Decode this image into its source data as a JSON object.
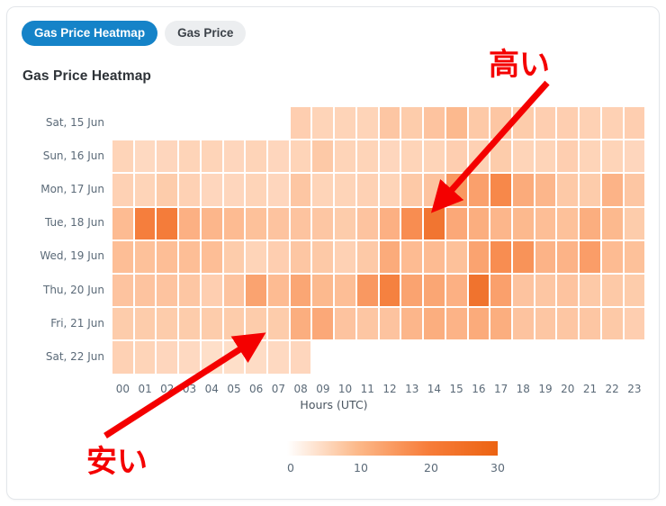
{
  "tabs": [
    {
      "label": "Gas Price Heatmap",
      "active": true
    },
    {
      "label": "Gas Price",
      "active": false
    }
  ],
  "chart_title": "Gas Price Heatmap",
  "annotations": [
    {
      "text": "高い",
      "meaning": "high",
      "color": "#f40000"
    },
    {
      "text": "安い",
      "meaning": "cheap",
      "color": "#f40000"
    }
  ],
  "legend": {
    "ticks": [
      "0",
      "10",
      "20",
      "30"
    ],
    "colors": [
      "#fdf0e6",
      "#fcb98a",
      "#f77d3a",
      "#ec6312"
    ]
  },
  "chart_data": {
    "type": "heatmap",
    "title": "Gas Price Heatmap",
    "xlabel": "Hours (UTC)",
    "ylabel": "",
    "categories_x": [
      "00",
      "01",
      "02",
      "03",
      "04",
      "05",
      "06",
      "07",
      "08",
      "09",
      "10",
      "11",
      "12",
      "13",
      "14",
      "15",
      "16",
      "17",
      "18",
      "19",
      "20",
      "21",
      "22",
      "23"
    ],
    "categories_y": [
      "Sat, 15 Jun",
      "Sun, 16 Jun",
      "Mon, 17 Jun",
      "Tue, 18 Jun",
      "Wed, 19 Jun",
      "Thu, 20 Jun",
      "Fri, 21 Jun",
      "Sat, 22 Jun"
    ],
    "zlim": [
      0,
      30
    ],
    "colorscale": [
      "#ffffff",
      "#ec6312"
    ],
    "grid": true,
    "legend_position": "bottom",
    "values": [
      [
        null,
        null,
        null,
        null,
        null,
        null,
        null,
        null,
        7.5,
        6.5,
        6.5,
        6.5,
        9.0,
        8.0,
        9.5,
        11.5,
        8.5,
        9.0,
        8.0,
        7.5,
        7.5,
        7.0,
        7.0,
        7.5
      ],
      [
        6.5,
        5.5,
        6.0,
        6.5,
        6.5,
        6.0,
        6.5,
        6.0,
        6.5,
        8.5,
        6.5,
        6.5,
        6.0,
        6.5,
        6.5,
        7.5,
        7.0,
        8.0,
        6.5,
        6.5,
        7.5,
        6.5,
        6.5,
        6.0
      ],
      [
        7.0,
        6.5,
        8.0,
        7.0,
        6.0,
        6.0,
        6.5,
        6.0,
        9.0,
        6.5,
        6.5,
        7.0,
        6.5,
        8.5,
        9.5,
        17.5,
        16.0,
        20.5,
        14.0,
        12.0,
        8.5,
        8.0,
        12.5,
        9.0
      ],
      [
        11.0,
        22.5,
        23.0,
        13.0,
        12.0,
        11.0,
        10.0,
        9.5,
        9.5,
        9.0,
        8.0,
        9.5,
        13.0,
        19.5,
        24.5,
        14.5,
        13.5,
        12.0,
        11.5,
        10.5,
        10.0,
        13.5,
        11.5,
        8.0
      ],
      [
        10.5,
        10.0,
        10.5,
        10.5,
        10.5,
        8.0,
        6.5,
        7.5,
        9.0,
        8.5,
        7.0,
        8.5,
        14.0,
        11.0,
        11.0,
        10.0,
        15.5,
        19.5,
        18.5,
        12.5,
        12.5,
        16.5,
        11.0,
        10.0
      ],
      [
        9.5,
        9.5,
        9.5,
        9.0,
        7.5,
        9.5,
        15.5,
        11.0,
        15.0,
        11.5,
        10.5,
        17.5,
        22.0,
        15.5,
        15.0,
        13.0,
        25.0,
        16.0,
        9.5,
        9.0,
        9.5,
        8.5,
        8.5,
        8.0
      ],
      [
        8.0,
        8.0,
        8.0,
        8.0,
        8.0,
        8.0,
        8.0,
        8.0,
        13.5,
        14.5,
        9.5,
        9.0,
        9.5,
        12.0,
        13.5,
        12.5,
        14.0,
        13.5,
        9.5,
        9.0,
        9.0,
        9.0,
        8.5,
        7.5
      ],
      [
        7.0,
        6.5,
        6.0,
        5.5,
        4.5,
        4.5,
        5.0,
        5.5,
        6.0,
        null,
        null,
        null,
        null,
        null,
        null,
        null,
        null,
        null,
        null,
        null,
        null,
        null,
        null,
        null
      ]
    ]
  }
}
